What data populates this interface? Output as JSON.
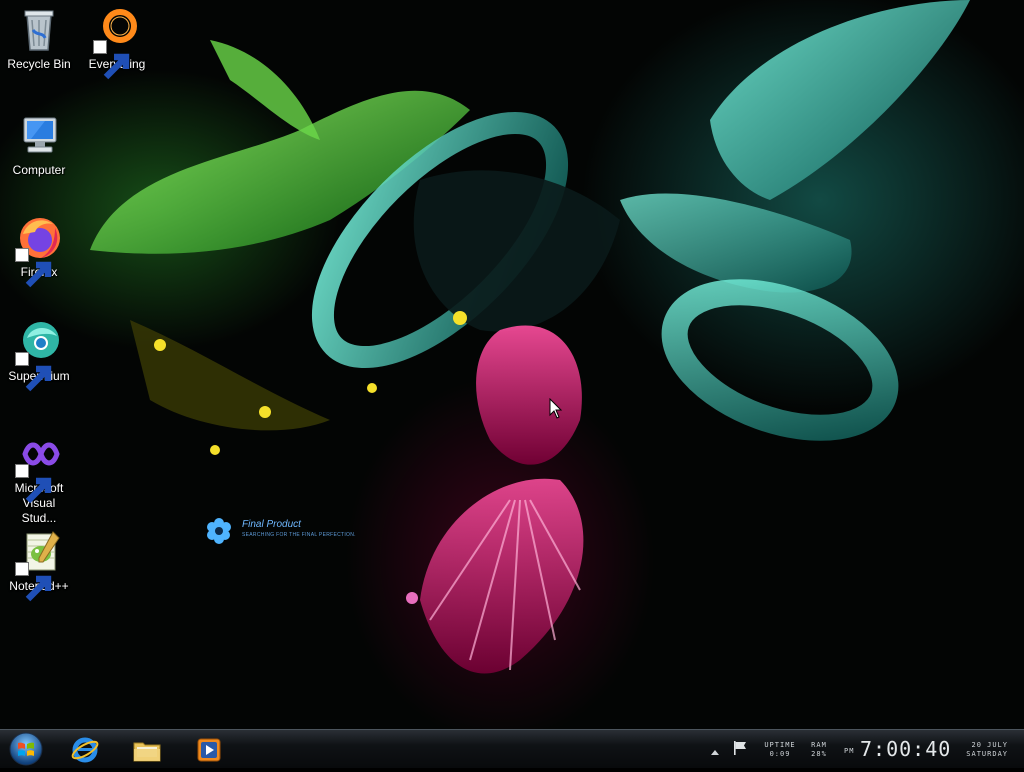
{
  "desktop": {
    "icons": [
      {
        "label": "Recycle Bin",
        "icon": "recycle-bin-icon",
        "shortcut": false
      },
      {
        "label": "Everything",
        "icon": "everything-search-icon",
        "shortcut": true
      },
      {
        "label": "Computer",
        "icon": "computer-icon",
        "shortcut": false
      },
      {
        "label": "Firefox",
        "icon": "firefox-icon",
        "shortcut": true
      },
      {
        "label": "Supermium",
        "icon": "supermium-icon",
        "shortcut": true
      },
      {
        "label": "Microsoft Visual Stud...",
        "icon": "visual-studio-icon",
        "shortcut": true
      },
      {
        "label": "Notepad++",
        "icon": "notepadpp-icon",
        "shortcut": true
      }
    ],
    "widget": {
      "title": "Final Product",
      "subtitle": "SEARCHING FOR THE FINAL PERFECTION."
    }
  },
  "taskbar": {
    "start": "start-orb-icon",
    "pinned": [
      {
        "name": "Internet Explorer",
        "icon": "internet-explorer-icon"
      },
      {
        "name": "Windows Explorer",
        "icon": "folder-icon"
      },
      {
        "name": "Media Player",
        "icon": "media-player-icon"
      }
    ],
    "tray": {
      "uptime_label": "UPTIME",
      "uptime_value": "0:09",
      "ram_label": "RAM",
      "ram_value": "28%",
      "ampm": "PM",
      "time": "7:00:40",
      "date": "20 JULY",
      "weekday": "SATURDAY"
    }
  },
  "colors": {
    "label_text": "#ffffff",
    "taskbar_bg": "#0f1215",
    "widget_text": "#6fb8ff"
  }
}
